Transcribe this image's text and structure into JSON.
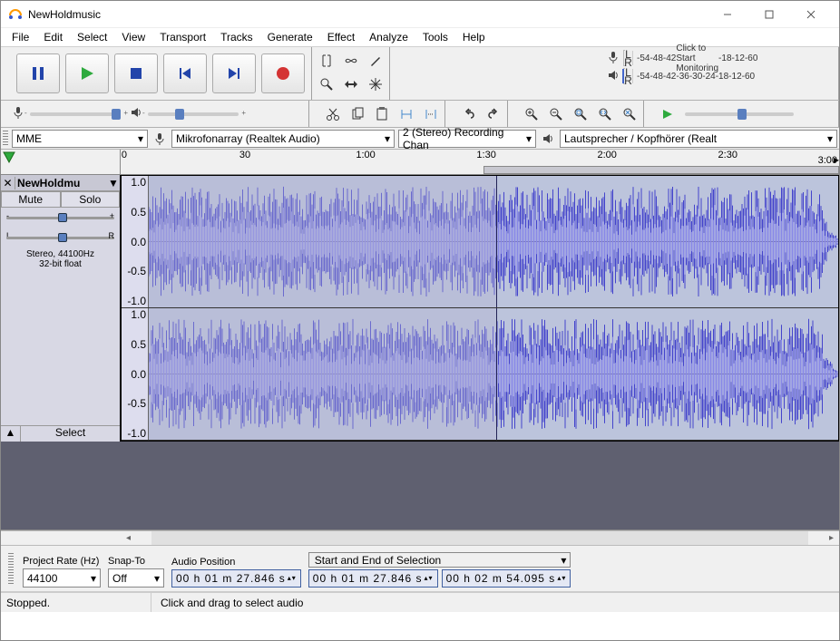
{
  "window": {
    "title": "NewHoldmusic"
  },
  "menu": {
    "items": [
      "File",
      "Edit",
      "Select",
      "View",
      "Transport",
      "Tracks",
      "Generate",
      "Effect",
      "Analyze",
      "Tools",
      "Help"
    ]
  },
  "meters": {
    "recording": {
      "click_text": "Click to Start Monitoring",
      "scale": [
        "-54",
        "-48",
        "-42",
        "",
        "",
        "",
        "-18",
        "-12",
        "-6",
        "0"
      ]
    },
    "playback": {
      "scale": [
        "-54",
        "-48",
        "-42",
        "-36",
        "-30",
        "-24",
        "-18",
        "-12",
        "-6",
        "0"
      ]
    },
    "channel_labels": [
      "L",
      "R"
    ]
  },
  "devices": {
    "host": "MME",
    "input": "Mikrofonarray (Realtek Audio)",
    "channels": "2 (Stereo) Recording Chan",
    "output": "Lautsprecher / Kopfhörer (Realt"
  },
  "timeline": {
    "labels": [
      "0",
      "30",
      "1:00",
      "1:30",
      "2:00",
      "2:30"
    ],
    "end_label": "3:00"
  },
  "track": {
    "name": "NewHoldmu",
    "mute": "Mute",
    "solo": "Solo",
    "gain_minus": "-",
    "gain_plus": "+",
    "pan_l": "L",
    "pan_r": "R",
    "format_line1": "Stereo, 44100Hz",
    "format_line2": "32-bit float",
    "select_btn": "Select",
    "amp_scale": [
      "1.0",
      "0.5",
      "0.0",
      "-0.5",
      "-1.0"
    ]
  },
  "selection_bar": {
    "project_rate_label": "Project Rate (Hz)",
    "project_rate_value": "44100",
    "snap_label": "Snap-To",
    "snap_value": "Off",
    "audio_pos_label": "Audio Position",
    "audio_pos_value": "00 h 01 m 27.846 s",
    "sel_mode_label": "Start and End of Selection",
    "sel_start": "00 h 01 m 27.846 s",
    "sel_end": "00 h 02 m 54.095 s"
  },
  "status": {
    "state": "Stopped.",
    "hint": "Click and drag to select audio"
  }
}
